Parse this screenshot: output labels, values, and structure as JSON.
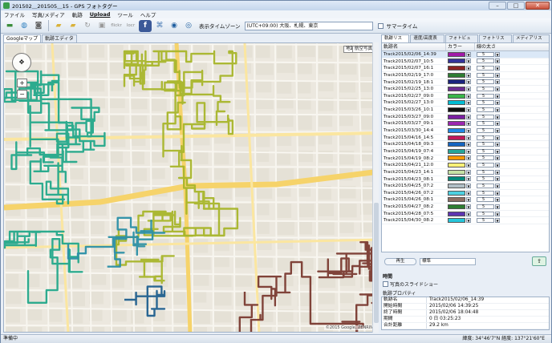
{
  "window": {
    "title": "201502＿201505＿15 - GPS フォトタグー",
    "controls": [
      "–",
      "□",
      "✕"
    ]
  },
  "menu": [
    "ファイル",
    "写真/メディア",
    "軌跡",
    "Upload",
    "ツール",
    "ヘルプ"
  ],
  "toolbar": {
    "tz_label": "表示タイムゾーン",
    "tz_value": "(UTC+09:00) 大阪、札幌、東京",
    "summer_time": "サマータイム",
    "icons": [
      "folder-open-icon",
      "globe-icon",
      "camera-icon",
      "folder-icon",
      "folder-icon",
      "refresh-icon",
      "photo-icon",
      "flickr-icon",
      "locr-icon",
      "facebook-icon",
      "tags-icon",
      "upload-icon",
      "sync-icon"
    ],
    "flickr": "flickr",
    "locr": "locr"
  },
  "left_tabs": [
    "Googleマップ",
    "軌跡エディタ"
  ],
  "map": {
    "type_buttons": [
      "地図",
      "航空写真"
    ],
    "copyright": "©2015 Google, ZENRIN",
    "zoom_in": "+",
    "zoom_out": "−",
    "pan": "✥",
    "colors": {
      "road": "#f8f6f0",
      "major_road": "#f6d36a",
      "block": "#e5e1d6"
    },
    "track_colors": [
      "#23a88a",
      "#a8b52a",
      "#7a3a30",
      "#2b8fa6",
      "#1f5f8e"
    ]
  },
  "right_tabs": [
    "軌跡リスト",
    "速度/高度表示",
    "フォトビュー",
    "フォトリスト",
    "メディアリスト"
  ],
  "tracks": {
    "headers": [
      "軌跡名",
      "カラー",
      "線の太さ"
    ],
    "rows": [
      {
        "name": "Track2015/02/06_14:39",
        "color": "#a01aa8",
        "width": "5"
      },
      {
        "name": "Track2015/02/07_10:5",
        "color": "#333399",
        "width": "5"
      },
      {
        "name": "Track2015/02/07_16:1",
        "color": "#8b2323",
        "width": "5"
      },
      {
        "name": "Track2015/02/19_17:0",
        "color": "#2e7d32",
        "width": "5"
      },
      {
        "name": "Track2015/02/19_18:1",
        "color": "#1a237e",
        "width": "5"
      },
      {
        "name": "Track2015/02/25_13:0",
        "color": "#6b2c91",
        "width": "5"
      },
      {
        "name": "Track2015/02/27_09:0",
        "color": "#39b54a",
        "width": "5"
      },
      {
        "name": "Track2015/02/27_13:0",
        "color": "#00bcd4",
        "width": "5"
      },
      {
        "name": "Track2015/03/26_10:1",
        "color": "#111111",
        "width": "5"
      },
      {
        "name": "Track2015/03/27_09:0",
        "color": "#7a1fa2",
        "width": "5"
      },
      {
        "name": "Track2015/03/27_09:1",
        "color": "#9c27b0",
        "width": "5"
      },
      {
        "name": "Track2015/03/30_14:4",
        "color": "#1e88e5",
        "width": "5"
      },
      {
        "name": "Track2015/04/16_14:5",
        "color": "#c2185b",
        "width": "5"
      },
      {
        "name": "Track2015/04/18_09:3",
        "color": "#1565c0",
        "width": "5"
      },
      {
        "name": "Track2015/04/19_07:4",
        "color": "#26a69a",
        "width": "5"
      },
      {
        "name": "Track2015/04/19_08:2",
        "color": "#ff9800",
        "width": "5"
      },
      {
        "name": "Track2015/04/21_12:0",
        "color": "#fff176",
        "width": "5"
      },
      {
        "name": "Track2015/04/23_14:1",
        "color": "#c5e1a5",
        "width": "5"
      },
      {
        "name": "Track2015/04/23_08:1",
        "color": "#00897b",
        "width": "5"
      },
      {
        "name": "Track2015/04/25_07:2",
        "color": "#b0bec5",
        "width": "5"
      },
      {
        "name": "Track2015/04/26_07:2",
        "color": "#4dd0e1",
        "width": "5"
      },
      {
        "name": "Track2015/04/26_08:1",
        "color": "#8d6e63",
        "width": "5"
      },
      {
        "name": "Track2015/04/27_08:2",
        "color": "#2e7d32",
        "width": "5"
      },
      {
        "name": "Track2015/04/28_07:5",
        "color": "#5e35b1",
        "width": "5"
      },
      {
        "name": "Track2015/04/30_08:2",
        "color": "#26c6da",
        "width": "5"
      }
    ]
  },
  "player": {
    "play": "再生",
    "speed": "標準"
  },
  "time_label": "時間",
  "slideshow": "写真のスライドショー",
  "props": {
    "title": "軌跡プロパティ",
    "rows": [
      {
        "k": "軌跡名",
        "v": "Track2015/02/06_14:39"
      },
      {
        "k": "開始時間",
        "v": "2015/02/06 14:39:25"
      },
      {
        "k": "終了時間",
        "v": "2015/02/06 18:04:48"
      },
      {
        "k": "期間",
        "v": "0 日 03:25:23"
      },
      {
        "k": "合計距離",
        "v": "29.2 km"
      }
    ]
  },
  "status": {
    "left": "準備中",
    "right": "緯度: 34°46'7\"N  経度: 137°21'60\"E"
  }
}
